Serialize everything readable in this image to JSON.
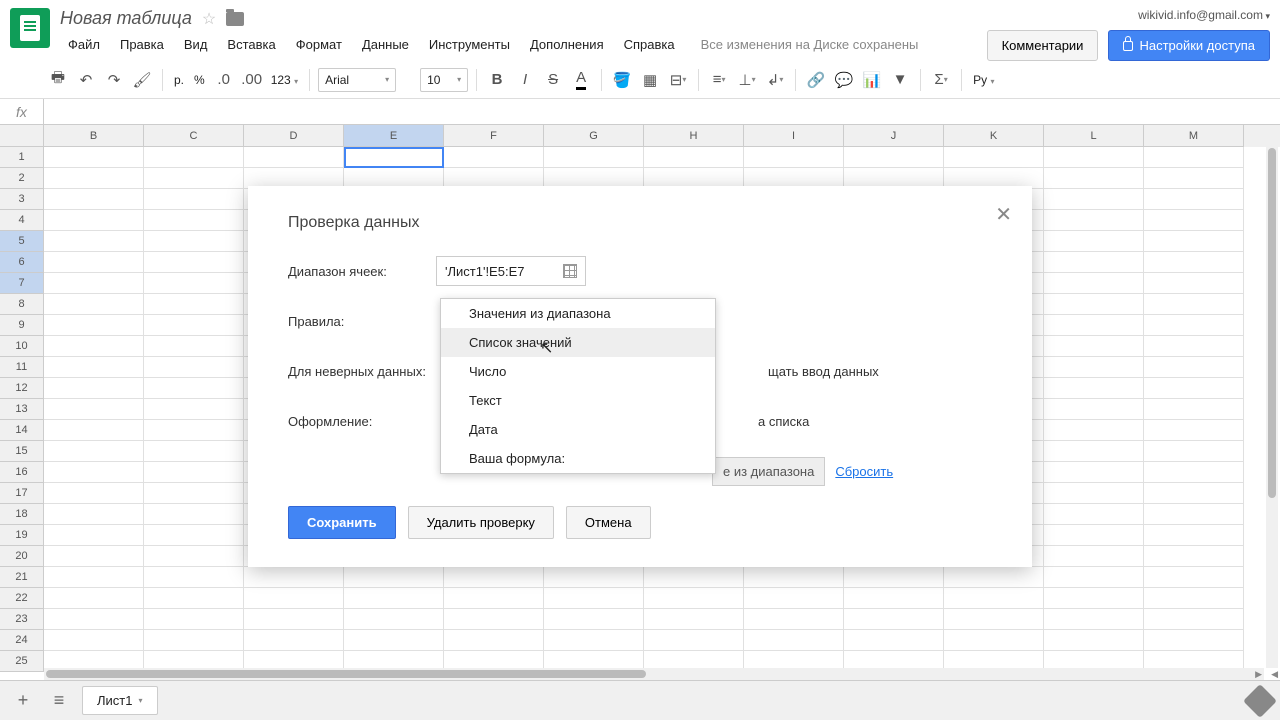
{
  "header": {
    "doc_title": "Новая таблица",
    "email": "wikivid.info@gmail.com",
    "comments_btn": "Комментарии",
    "share_btn": "Настройки доступа"
  },
  "menu": {
    "items": [
      "Файл",
      "Правка",
      "Вид",
      "Вставка",
      "Формат",
      "Данные",
      "Инструменты",
      "Дополнения",
      "Справка"
    ],
    "save_status": "Все изменения на Диске сохранены"
  },
  "toolbar": {
    "font": "Arial",
    "size": "10",
    "currency": "р.",
    "percent": "%",
    "num_fmt": "123",
    "lang": "Ру"
  },
  "columns": [
    "B",
    "C",
    "D",
    "E",
    "F",
    "G",
    "H",
    "I",
    "J",
    "K",
    "L",
    "M"
  ],
  "selected_col": "E",
  "rows": [
    1,
    2,
    3,
    4,
    5,
    6,
    7,
    8,
    9,
    10,
    11,
    12,
    13,
    14,
    15,
    16,
    17,
    18,
    19,
    20,
    21,
    22,
    23,
    24,
    25
  ],
  "selected_rows": [
    5,
    6,
    7
  ],
  "sheet": {
    "name": "Лист1"
  },
  "dialog": {
    "title": "Проверка данных",
    "cell_range_label": "Диапазон ячеек:",
    "cell_range_value": "'Лист1'!E5:E7",
    "rules_label": "Правила:",
    "invalid_label": "Для неверных данных:",
    "invalid_text_partial": "щать ввод данных",
    "appearance_label": "Оформление:",
    "appearance_text_partial": "а списка",
    "hint_partial": "е из диапазона",
    "reset": "Сбросить",
    "secondary_range_partial": "/",
    "save": "Сохранить",
    "delete": "Удалить проверку",
    "cancel": "Отмена"
  },
  "dropdown": {
    "items": [
      "Значения из диапазона",
      "Список значений",
      "Число",
      "Текст",
      "Дата",
      "Ваша формула:"
    ],
    "hover_index": 1
  }
}
